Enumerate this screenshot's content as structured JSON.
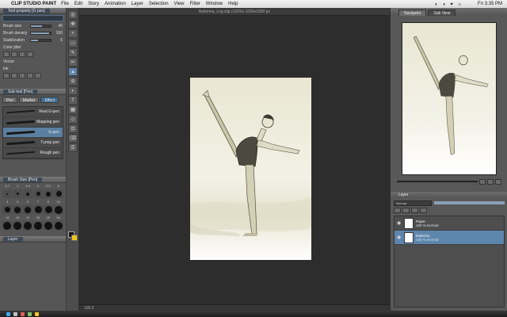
{
  "menubar": {
    "app_name": "CLIP STUDIO PAINT",
    "items": [
      "File",
      "Edit",
      "Story",
      "Animation",
      "Layer",
      "Selection",
      "View",
      "Filter",
      "Window",
      "Help"
    ],
    "tray": "◐ ◑ ✦ ⌂",
    "clock": "Fri 3:35 PM"
  },
  "left_panel": {
    "tool_property_title": "Tool property [G pen]",
    "properties": [
      {
        "label": "Brush size",
        "value": "40",
        "fill": 0.55
      },
      {
        "label": "Brush density",
        "value": "100",
        "fill": 0.9
      },
      {
        "label": "Stabilization",
        "value": "6",
        "fill": 0.35
      },
      {
        "label": "Color jitter",
        "value": "",
        "fill": 0.0
      },
      {
        "label": "Vector",
        "value": "",
        "fill": 0.0
      },
      {
        "label": "Ink",
        "value": "",
        "fill": 0.0
      }
    ],
    "subtool_title": "Sub tool [Pen]",
    "subtool_chips": [
      "Pen",
      "Marker",
      "Effect"
    ],
    "brushes": [
      {
        "name": "Real G-pen"
      },
      {
        "name": "Mapping pen"
      },
      {
        "name": "G-pen"
      },
      {
        "name": "Turnip pen"
      },
      {
        "name": "Rough pen"
      }
    ],
    "brush_size_title": "Brush Size [Pen]",
    "size_labels": [
      "0.7",
      "1",
      "1.5",
      "2",
      "2.5",
      "3",
      "4",
      "5",
      "6",
      "7",
      "8",
      "10",
      "12",
      "15",
      "17",
      "20",
      "25",
      "30"
    ],
    "layer_tab": "Layer"
  },
  "toolbar": {
    "tools": [
      "◎",
      "✥",
      "⌕",
      "▭",
      "✎",
      "✏",
      "▲",
      "⊘",
      "◐",
      "T",
      "▦",
      "◇",
      "⊡",
      "⌫",
      "☰"
    ]
  },
  "canvas": {
    "doc_title": "Ballerina_Leg.clip (100%) 1000x1500 px",
    "footer": "100.0"
  },
  "right_panel": {
    "tabs": [
      "Navigator",
      "Sub View"
    ],
    "layer_title": "Layer",
    "blend_mode": "Normal",
    "layers": [
      {
        "name": "Paper",
        "sub": "100 % Normal",
        "selected": false
      },
      {
        "name": "Ballerina",
        "sub": "100 % Normal",
        "selected": true
      }
    ]
  },
  "colors": {
    "ui_bg": "#2b2b2b",
    "panel": "#565656",
    "accent": "#5d86ad",
    "main_color": "#111111",
    "sub_color": "#f0c419"
  }
}
